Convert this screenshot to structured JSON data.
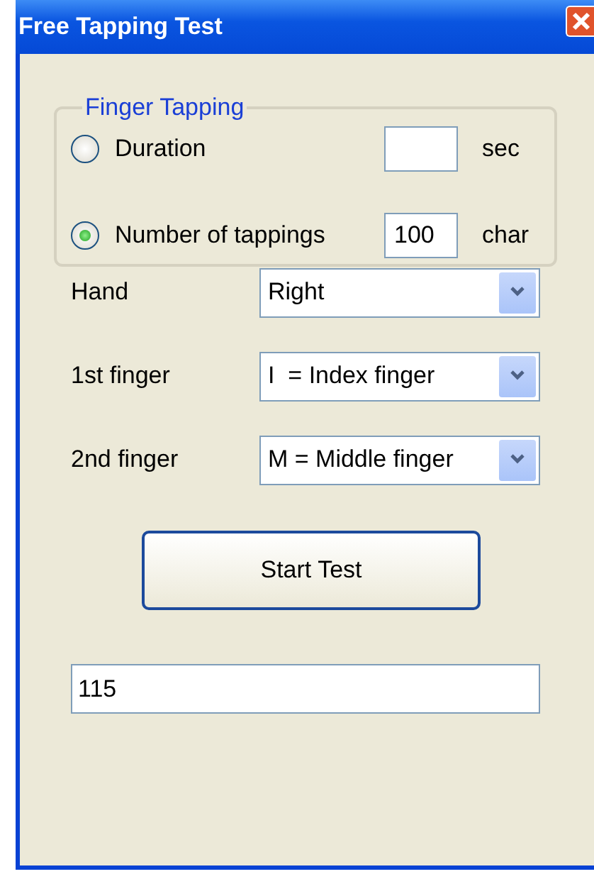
{
  "window": {
    "title": "Free Tapping Test"
  },
  "group": {
    "legend": "Finger Tapping",
    "options": [
      {
        "label": "Duration",
        "selected": false,
        "unit": "sec"
      },
      {
        "label": "Number of tappings",
        "selected": true,
        "value": "100",
        "unit": "char"
      }
    ]
  },
  "selects": [
    {
      "label": "Hand",
      "value": "Right"
    },
    {
      "label": "1st finger",
      "value": "I  = Index finger"
    },
    {
      "label": "2nd finger",
      "value": "M = Middle finger"
    }
  ],
  "start_button": "Start Test",
  "result": {
    "value": "115"
  }
}
